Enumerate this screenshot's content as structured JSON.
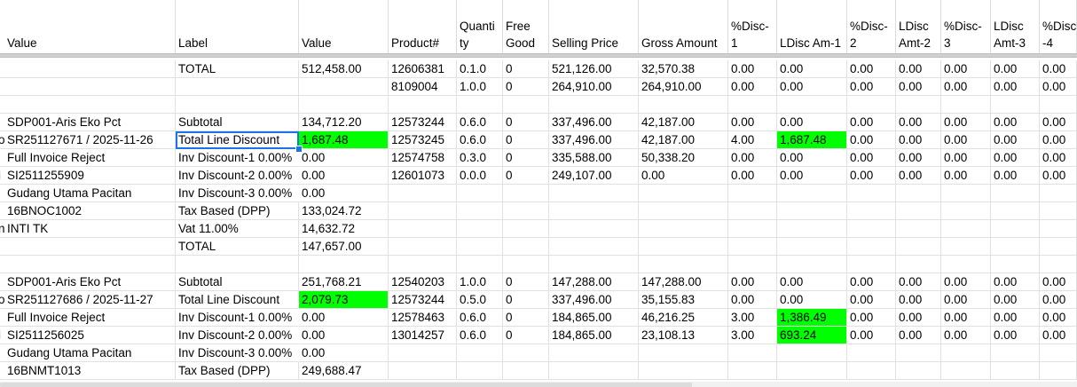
{
  "columns": [
    {
      "key": "a",
      "label": "Value"
    },
    {
      "key": "b",
      "label": "Label"
    },
    {
      "key": "c",
      "label": "Value"
    },
    {
      "key": "d",
      "label": "Product#"
    },
    {
      "key": "e",
      "label": "Quanti\nty"
    },
    {
      "key": "f",
      "label": "Free\nGood"
    },
    {
      "key": "g",
      "label": "Selling Price"
    },
    {
      "key": "h",
      "label": "Gross Amount"
    },
    {
      "key": "i",
      "label": "%Disc-\n1"
    },
    {
      "key": "j",
      "label": "LDisc Am-1"
    },
    {
      "key": "k",
      "label": "%Disc-\n2"
    },
    {
      "key": "l",
      "label": "LDisc\nAmt-2"
    },
    {
      "key": "m",
      "label": "%Disc-\n3"
    },
    {
      "key": "n",
      "label": "LDisc\nAmt-3"
    },
    {
      "key": "o",
      "label": "%Disc\n-4"
    }
  ],
  "rows": [
    {
      "b": "TOTAL",
      "c": "512,458.00",
      "d": "12606381",
      "e": "0.1.0",
      "f": "0",
      "g": "521,126.00",
      "h": "32,570.38",
      "i": "0.00",
      "j": "0.00",
      "k": "0.00",
      "l": "0.00",
      "m": "0.00",
      "n": "0.00",
      "o": "0.00"
    },
    {
      "d": "8109004",
      "e": "1.0.0",
      "f": "0",
      "g": "264,910.00",
      "h": "264,910.00",
      "i": "0.00",
      "j": "0.00",
      "k": "0.00",
      "l": "0.00",
      "m": "0.00",
      "n": "0.00",
      "o": "0.00"
    },
    {},
    {
      "a": "SDP001-Aris Eko Pct",
      "b": "Subtotal",
      "c": "134,712.20",
      "d": "12573244",
      "e": "0.6.0",
      "f": "0",
      "g": "337,496.00",
      "h": "42,187.00",
      "i": "0.00",
      "j": "0.00",
      "k": "0.00",
      "l": "0.00",
      "m": "0.00",
      "n": "0.00",
      "o": "0.00"
    },
    {
      "a": "SR251127671 / 2025-11-26",
      "a_prefix": "o",
      "b": "Total Line Discount",
      "c": "1,687.48",
      "d": "12573245",
      "e": "0.6.0",
      "f": "0",
      "g": "337,496.00",
      "h": "42,187.00",
      "i": "4.00",
      "j": "1,687.48",
      "k": "0.00",
      "l": "0.00",
      "m": "0.00",
      "n": "0.00",
      "o": "0.00"
    },
    {
      "a": "Full Invoice Reject",
      "b": "Inv Discount-1 0.00%",
      "c": "0.00",
      "d": "12574758",
      "e": "0.3.0",
      "f": "0",
      "g": "335,588.00",
      "h": "50,338.20",
      "i": "0.00",
      "j": "0.00",
      "k": "0.00",
      "l": "0.00",
      "m": "0.00",
      "n": "0.00",
      "o": "0.00"
    },
    {
      "a": "SI2511255909",
      "a_prefix": "i",
      "b": "Inv Discount-2 0.00%",
      "c": "0.00",
      "d": "12601073",
      "e": "0.0.0",
      "f": "0",
      "g": "249,107.00",
      "h": "0.00",
      "i": "0.00",
      "j": "0.00",
      "k": "0.00",
      "l": "0.00",
      "m": "0.00",
      "n": "0.00",
      "o": "0.00"
    },
    {
      "a": "Gudang Utama Pacitan",
      "b": "Inv Discount-3 0.00%",
      "c": "0.00"
    },
    {
      "a": "16BNOC1002",
      "b": "Tax Based (DPP)",
      "c": "133,024.72"
    },
    {
      "a": "INTI TK",
      "a_prefix": "n",
      "b": "Vat 11.00%",
      "c": "14,632.72"
    },
    {
      "b": "TOTAL",
      "c": "147,657.00"
    },
    {},
    {
      "a": "SDP001-Aris Eko Pct",
      "b": "Subtotal",
      "c": "251,768.21",
      "d": "12540203",
      "e": "1.0.0",
      "f": "0",
      "g": "147,288.00",
      "h": "147,288.00",
      "i": "0.00",
      "j": "0.00",
      "k": "0.00",
      "l": "0.00",
      "m": "0.00",
      "n": "0.00",
      "o": "0.00"
    },
    {
      "a": "SR251127686 / 2025-11-27",
      "a_prefix": "o",
      "b": "Total Line Discount",
      "c": "2,079.73",
      "d": "12573244",
      "e": "0.5.0",
      "f": "0",
      "g": "337,496.00",
      "h": "35,155.83",
      "i": "0.00",
      "j": "0.00",
      "k": "0.00",
      "l": "0.00",
      "m": "0.00",
      "n": "0.00",
      "o": "0.00"
    },
    {
      "a": "Full Invoice Reject",
      "b": "Inv Discount-1 0.00%",
      "c": "0.00",
      "d": "12578463",
      "e": "0.6.0",
      "f": "0",
      "g": "184,865.00",
      "h": "46,216.25",
      "i": "3.00",
      "j": "1,386.49",
      "k": "0.00",
      "l": "0.00",
      "m": "0.00",
      "n": "0.00",
      "o": "0.00"
    },
    {
      "a": "SI2511256025",
      "a_prefix": "i",
      "b": "Inv Discount-2 0.00%",
      "c": "0.00",
      "d": "13014257",
      "e": "0.6.0",
      "f": "0",
      "g": "184,865.00",
      "h": "23,108.13",
      "i": "3.00",
      "j": "693.24",
      "k": "0.00",
      "l": "0.00",
      "m": "0.00",
      "n": "0.00",
      "o": "0.00"
    },
    {
      "a": "Gudang Utama Pacitan",
      "b": "Inv Discount-3 0.00%",
      "c": "0.00"
    },
    {
      "a": "16BNMT1013",
      "b": "Tax Based (DPP)",
      "c": "249,688.47"
    }
  ],
  "highlights": {
    "color": "#00ff00",
    "cells": [
      [
        4,
        "c"
      ],
      [
        4,
        "j"
      ],
      [
        13,
        "c"
      ],
      [
        14,
        "j"
      ],
      [
        15,
        "j"
      ]
    ]
  },
  "selection": {
    "row": 4,
    "col": "b",
    "accent": "#1a73e8"
  }
}
